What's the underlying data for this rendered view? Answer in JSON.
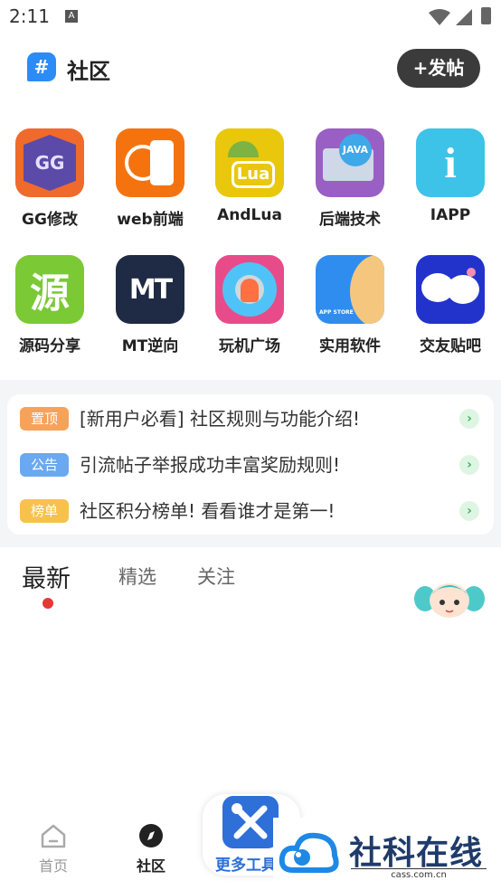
{
  "status_bar": {
    "time": "2:11",
    "notification_icon": "A"
  },
  "header": {
    "logo_icon": "hash-chat-icon",
    "logo_glyph": "#",
    "title": "社区",
    "post_button": "+发帖"
  },
  "categories": [
    {
      "label": "GG修改",
      "icon": "gg-icon",
      "glyph": "GG",
      "color": "#5b4aa8"
    },
    {
      "label": "web前端",
      "icon": "web-phone-icon",
      "glyph": "",
      "color": "#f5730f"
    },
    {
      "label": "AndLua",
      "icon": "android-lua-icon",
      "glyph": "Lua",
      "color": "#e9c70c"
    },
    {
      "label": "后端技术",
      "icon": "backend-icon",
      "glyph": "JAVA",
      "color": "#9a5fc4"
    },
    {
      "label": "IAPP",
      "icon": "iapp-icon",
      "glyph": "i",
      "color": "#3ec3e8"
    },
    {
      "label": "源码分享",
      "icon": "source-icon",
      "glyph": "源",
      "color": "#7bc934"
    },
    {
      "label": "MT逆向",
      "icon": "mt-icon",
      "glyph": "MT",
      "color": "#1f2a44"
    },
    {
      "label": "玩机广场",
      "icon": "android-tools-icon",
      "glyph": "",
      "color": "#e84b8a"
    },
    {
      "label": "实用软件",
      "icon": "app-store-icon",
      "glyph": "APP STORE",
      "color": "#2f8df0"
    },
    {
      "label": "交友贴吧",
      "icon": "chat-bubbles-icon",
      "glyph": "",
      "color": "#2233cc"
    }
  ],
  "notices": [
    {
      "tag": "置顶",
      "tag_color": "#f7a25b",
      "text": "[新用户必看] 社区规则与功能介绍!"
    },
    {
      "tag": "公告",
      "tag_color": "#6aa8f2",
      "text": "引流帖子举报成功丰富奖励规则!"
    },
    {
      "tag": "榜单",
      "tag_color": "#f7c24b",
      "text": "社区积分榜单! 看看谁才是第一!"
    }
  ],
  "feed_tabs": {
    "latest": "最新",
    "featured": "精选",
    "follow": "关注"
  },
  "bottom_nav": {
    "home": "首页",
    "community": "社区",
    "tools": "更多工具"
  },
  "watermark": {
    "title": "社科在线",
    "subtitle": "cass.com.cn"
  }
}
